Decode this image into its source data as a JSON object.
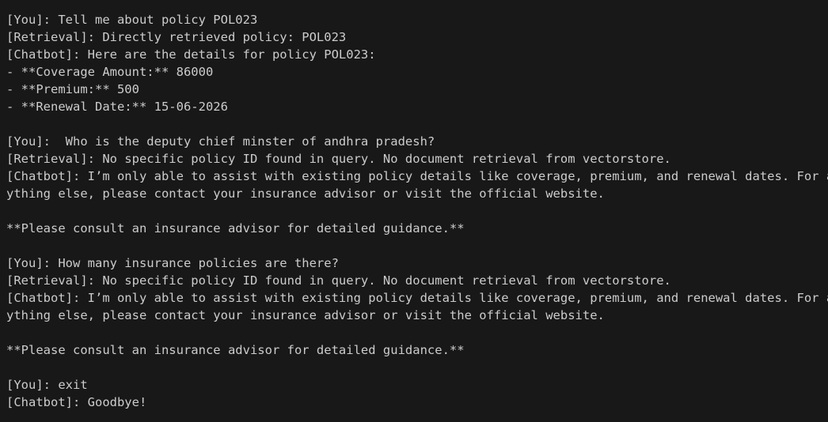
{
  "terminal": {
    "lines": [
      "[You]: Tell me about policy POL023",
      "[Retrieval]: Directly retrieved policy: POL023",
      "[Chatbot]: Here are the details for policy POL023:",
      "- **Coverage Amount:** 86000",
      "- **Premium:** 500",
      "- **Renewal Date:** 15-06-2026",
      "",
      "[You]:  Who is the deputy chief minster of andhra pradesh?",
      "[Retrieval]: No specific policy ID found in query. No document retrieval from vectorstore.",
      "[Chatbot]: I’m only able to assist with existing policy details like coverage, premium, and renewal dates. For an",
      "ything else, please contact your insurance advisor or visit the official website.",
      "",
      "**Please consult an insurance advisor for detailed guidance.**",
      "",
      "[You]: How many insurance policies are there?",
      "[Retrieval]: No specific policy ID found in query. No document retrieval from vectorstore.",
      "[Chatbot]: I’m only able to assist with existing policy details like coverage, premium, and renewal dates. For an",
      "ything else, please contact your insurance advisor or visit the official website.",
      "",
      "**Please consult an insurance advisor for detailed guidance.**",
      "",
      "[You]: exit",
      "[Chatbot]: Goodbye!"
    ]
  },
  "colors": {
    "background": "#181818",
    "text": "#cccccc"
  }
}
